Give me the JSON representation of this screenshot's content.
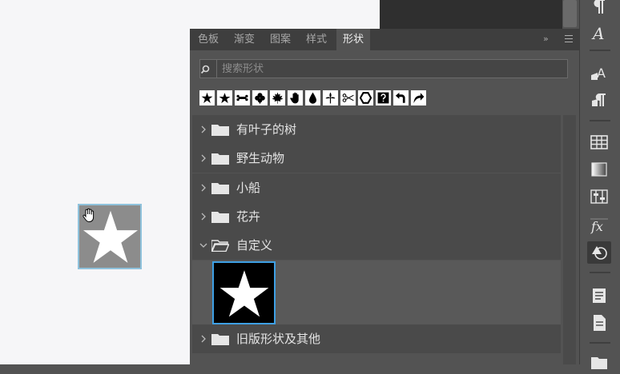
{
  "panel": {
    "tabs": [
      {
        "label": "色板",
        "active": false
      },
      {
        "label": "渐变",
        "active": false
      },
      {
        "label": "图案",
        "active": false
      },
      {
        "label": "样式",
        "active": false
      },
      {
        "label": "形状",
        "active": true
      }
    ],
    "collapse_label": "»",
    "search": {
      "placeholder": "搜索形状",
      "value": ""
    },
    "quick_shapes": [
      "star-icon",
      "star-5-icon",
      "bone-icon",
      "clover-icon",
      "maple-leaf-icon",
      "hand-icon",
      "drop-icon",
      "fleur-icon",
      "scissors-icon",
      "hexagon-icon",
      "question-icon",
      "turn-left-arrow-icon",
      "curved-arrow-icon"
    ],
    "groups": [
      {
        "label": "有叶子的树",
        "expanded": false
      },
      {
        "label": "野生动物",
        "expanded": false
      },
      {
        "label": "小船",
        "expanded": false
      },
      {
        "label": "花卉",
        "expanded": false
      },
      {
        "label": "自定义",
        "expanded": true
      },
      {
        "label": "旧版形状及其他",
        "expanded": false
      }
    ]
  },
  "toolbar": {
    "tools": [
      "paragraph-icon",
      "character-icon",
      "character-styles-icon",
      "paragraph-styles-icon",
      "table-icon",
      "gradient-icon",
      "adjustments-icon",
      "fx-icon",
      "shapes-icon",
      "notes-icon",
      "document-icon",
      "folder-icon"
    ],
    "active_tool": "shapes-icon"
  },
  "colors": {
    "panel_bg": "#535353",
    "tab_bar": "#3e3e3e",
    "selection": "#3ea0e4",
    "canvas_bg": "#f6f6f8"
  }
}
